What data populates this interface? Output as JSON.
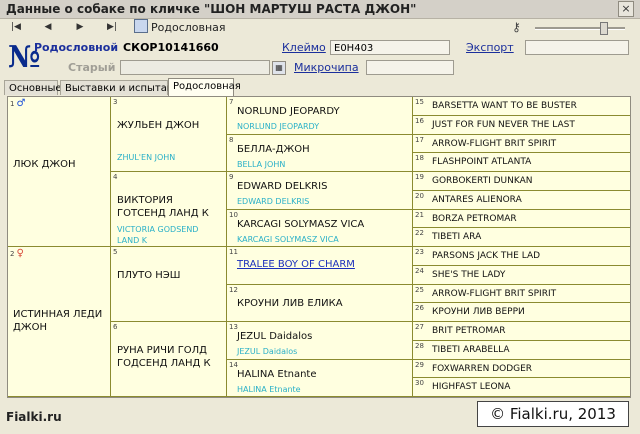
{
  "window": {
    "title": "Данные о собаке по кличке \"ШОН МАРТУШ РАСТА ДЖОН\"",
    "close_glyph": "×"
  },
  "toolbar": {
    "nav": [
      "|◀",
      "◀",
      "▶",
      "▶|"
    ],
    "rodoslovnaya_label": "Родословная"
  },
  "header": {
    "num_glyph": "№",
    "rodoslovnoy_label": "Родословной",
    "rodoslovnoy_value": "СКОР10141660",
    "kleimo_label": "Клеймо",
    "kleimo_value": "E0H403",
    "export_label": "Экспорт",
    "export_value": "",
    "stary_label": "Старый",
    "stary_value": "",
    "date_value": "",
    "microchip_label": "Микрочипа",
    "microchip_value": ""
  },
  "tabs": [
    {
      "label": "Основные"
    },
    {
      "label": "Выставки и испытания"
    },
    {
      "label": "Родословная"
    }
  ],
  "pedigree": {
    "g1": [
      {
        "num": "1",
        "sex": "♂",
        "name": "ЛЮК ДЖОН",
        "latin": ""
      },
      {
        "num": "2",
        "sex": "♀",
        "name": "ИСТИННАЯ ЛЕДИ ДЖОН",
        "latin": ""
      }
    ],
    "g2": [
      {
        "num": "3",
        "name": "ЖУЛЬЕН ДЖОН",
        "latin": "ZHUL'EN JOHN"
      },
      {
        "num": "4",
        "name": "ВИКТОРИЯ ГОТСЕНД ЛАНД К",
        "latin": "VICTORIA GODSEND LAND K"
      },
      {
        "num": "5",
        "name": "ПЛУТО НЭШ",
        "latin": ""
      },
      {
        "num": "6",
        "name": "РУНА РИЧИ ГОЛД ГОДСЕНД ЛАНД К",
        "latin": ""
      }
    ],
    "g3": [
      {
        "num": "7",
        "name": "NORLUND JEOPARDY",
        "latin": "NORLUND JEOPARDY"
      },
      {
        "num": "8",
        "name": "БЕЛЛА-ДЖОН",
        "latin": "BELLA JOHN"
      },
      {
        "num": "9",
        "name": "EDWARD DELKRIS",
        "latin": "EDWARD DELKRIS"
      },
      {
        "num": "10",
        "name": "KARCAGI SOLYMASZ VICA",
        "latin": "KARCAGI SOLYMASZ VICA"
      },
      {
        "num": "11",
        "name": "TRALEE BOY OF CHARM",
        "latin": ""
      },
      {
        "num": "12",
        "name": "КРОУНИ ЛИВ ЕЛИКА",
        "latin": ""
      },
      {
        "num": "13",
        "name": "JEZUL Daidalos",
        "latin": "JEZUL Daidalos"
      },
      {
        "num": "14",
        "name": "HALINA Etnante",
        "latin": "HALINA Etnante"
      }
    ],
    "g4": [
      {
        "num": "15",
        "name": "BARSETTA WANT TO BE BUSTER"
      },
      {
        "num": "16",
        "name": "JUST FOR FUN NEVER THE LAST"
      },
      {
        "num": "17",
        "name": "ARROW-FLIGHT BRIT SPIRIT"
      },
      {
        "num": "18",
        "name": "FLASHPOINT ATLANTA"
      },
      {
        "num": "19",
        "name": "GORBOKERTI DUNKAN"
      },
      {
        "num": "20",
        "name": "ANTARES ALIENORA"
      },
      {
        "num": "21",
        "name": "BORZA PETROMAR"
      },
      {
        "num": "22",
        "name": "TIBETI ARA"
      },
      {
        "num": "23",
        "name": "PARSONS JACK THE LAD"
      },
      {
        "num": "24",
        "name": "SHE'S THE LADY"
      },
      {
        "num": "25",
        "name": "ARROW-FLIGHT BRIT SPIRIT"
      },
      {
        "num": "26",
        "name": "КРОУНИ ЛИВ ВЕРРИ"
      },
      {
        "num": "27",
        "name": "BRIT PETROMAR"
      },
      {
        "num": "28",
        "name": "TIBETI ARABELLA"
      },
      {
        "num": "29",
        "name": "FOXWARREN DODGER"
      },
      {
        "num": "30",
        "name": "HIGHFAST LEONA"
      }
    ]
  },
  "footer": {
    "left": "Fialki.ru",
    "right": "© Fialki.ru, 2013"
  }
}
